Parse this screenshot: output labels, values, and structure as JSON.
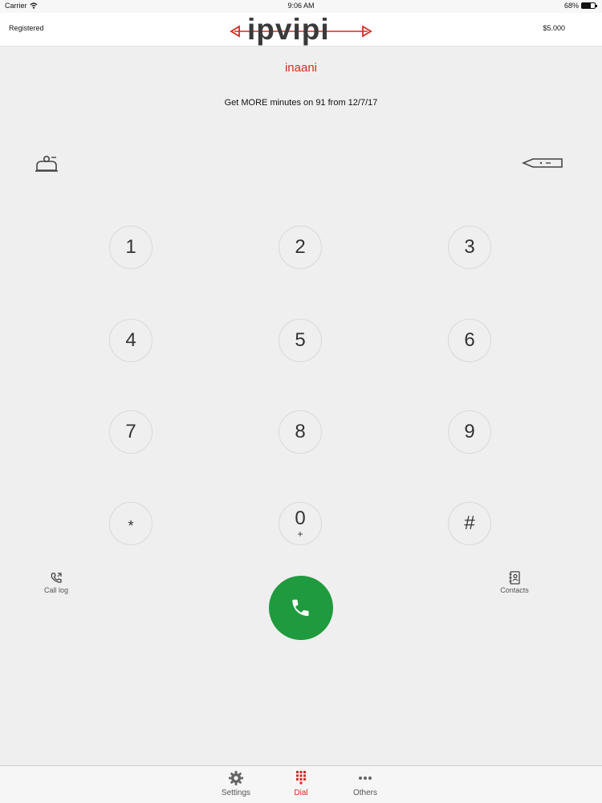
{
  "status_bar": {
    "carrier": "Carrier",
    "time": "9:06 AM",
    "battery": "68%",
    "battery_level": 0.68
  },
  "header": {
    "registration": "Registered",
    "brand": "ipvipi",
    "balance": "$5.000"
  },
  "user": {
    "name": "inaani"
  },
  "promo": {
    "text": "Get MORE minutes on 91 from 12/7/17"
  },
  "keypad": {
    "keys": [
      {
        "digit": "1",
        "sub": ""
      },
      {
        "digit": "2",
        "sub": ""
      },
      {
        "digit": "3",
        "sub": ""
      },
      {
        "digit": "4",
        "sub": ""
      },
      {
        "digit": "5",
        "sub": ""
      },
      {
        "digit": "6",
        "sub": ""
      },
      {
        "digit": "7",
        "sub": ""
      },
      {
        "digit": "8",
        "sub": ""
      },
      {
        "digit": "9",
        "sub": ""
      },
      {
        "digit": "*",
        "sub": ""
      },
      {
        "digit": "0",
        "sub": "+"
      },
      {
        "digit": "#",
        "sub": ""
      }
    ]
  },
  "actions": {
    "call_log": "Call log",
    "contacts": "Contacts",
    "call_icon": "phone-icon"
  },
  "tabs": [
    {
      "label": "Settings",
      "icon": "gear-icon",
      "active": false
    },
    {
      "label": "Dial",
      "icon": "dialpad-icon",
      "active": true
    },
    {
      "label": "Others",
      "icon": "more-icon",
      "active": false
    }
  ],
  "colors": {
    "accent": "#d62b22",
    "call": "#1f9a3e",
    "background": "#efefef"
  }
}
